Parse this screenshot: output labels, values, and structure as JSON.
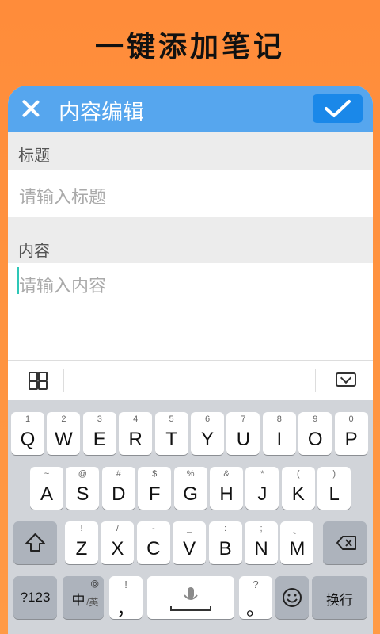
{
  "headline": "一键添加笔记",
  "appbar": {
    "title": "内容编辑"
  },
  "sections": {
    "title_label": "标题",
    "title_placeholder": "请输入标题",
    "content_label": "内容",
    "content_placeholder": "请输入内容"
  },
  "keyboard": {
    "row1": [
      [
        "1",
        "Q"
      ],
      [
        "2",
        "W"
      ],
      [
        "3",
        "E"
      ],
      [
        "4",
        "R"
      ],
      [
        "5",
        "T"
      ],
      [
        "6",
        "Y"
      ],
      [
        "7",
        "U"
      ],
      [
        "8",
        "I"
      ],
      [
        "9",
        "O"
      ],
      [
        "0",
        "P"
      ]
    ],
    "row2": [
      [
        "~",
        "A"
      ],
      [
        "@",
        "S"
      ],
      [
        "#",
        "D"
      ],
      [
        "$",
        "F"
      ],
      [
        "%",
        "G"
      ],
      [
        "&",
        "H"
      ],
      [
        "*",
        "J"
      ],
      [
        "(",
        "K"
      ],
      [
        ")",
        "L"
      ]
    ],
    "row3": [
      [
        "!",
        "Z"
      ],
      [
        "/",
        "X"
      ],
      [
        "-",
        "C"
      ],
      [
        "_",
        "V"
      ],
      [
        ":",
        "B"
      ],
      [
        ";",
        "N"
      ],
      [
        "、",
        "M"
      ]
    ],
    "num_label": "?123",
    "lang_label": "中",
    "lang_sub": "/英",
    "comma": "，",
    "comma_top": "!",
    "period": "。",
    "period_top": "?",
    "return_label": "换行"
  },
  "colors": {
    "appbar": "#56a6ee",
    "confirm": "#1a88e9",
    "background": "#ff8c3a",
    "caret": "#2ec7b7"
  }
}
